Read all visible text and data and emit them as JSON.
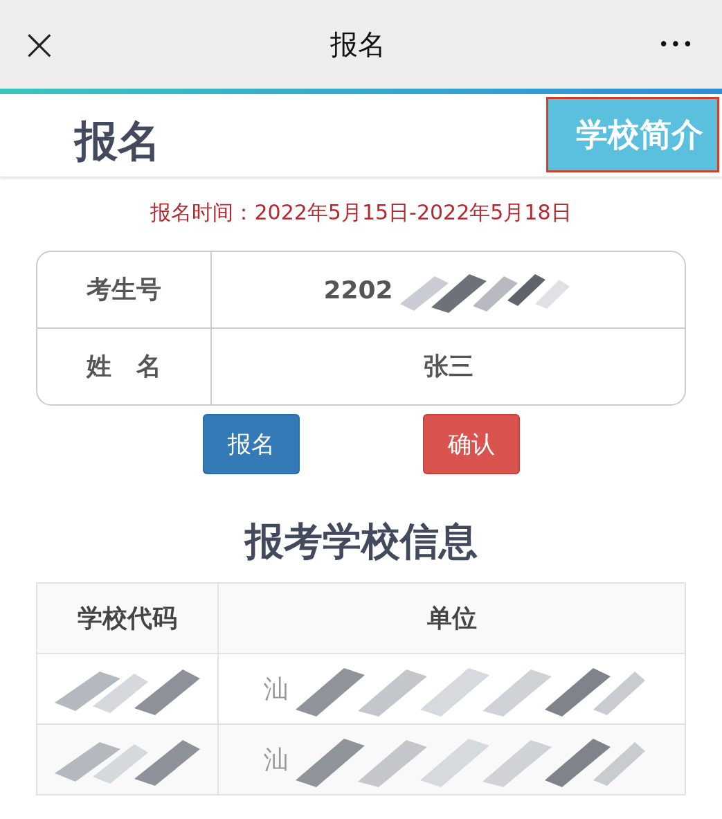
{
  "nav_bar": {
    "close": "×",
    "title": "报名",
    "more": "•••"
  },
  "header": {
    "title": "报名",
    "intro_button": "学校简介"
  },
  "period": "报名时间：2022年5月15日-2022年5月18日",
  "candidate": [
    {
      "label": "考生号",
      "value": "2202",
      "redacted": true
    },
    {
      "label": "姓　名",
      "value": "张三",
      "redacted": false
    }
  ],
  "buttons": [
    {
      "label": "报名",
      "kind": "primary"
    },
    {
      "label": "确认",
      "kind": "danger"
    }
  ],
  "school_section": {
    "title": "报考学校信息",
    "columns": [
      "学校代码",
      "单位"
    ],
    "rows": [
      {
        "code": "",
        "unit": "汕",
        "redacted": true
      },
      {
        "code": "",
        "unit": "汕",
        "redacted": true
      }
    ]
  }
}
